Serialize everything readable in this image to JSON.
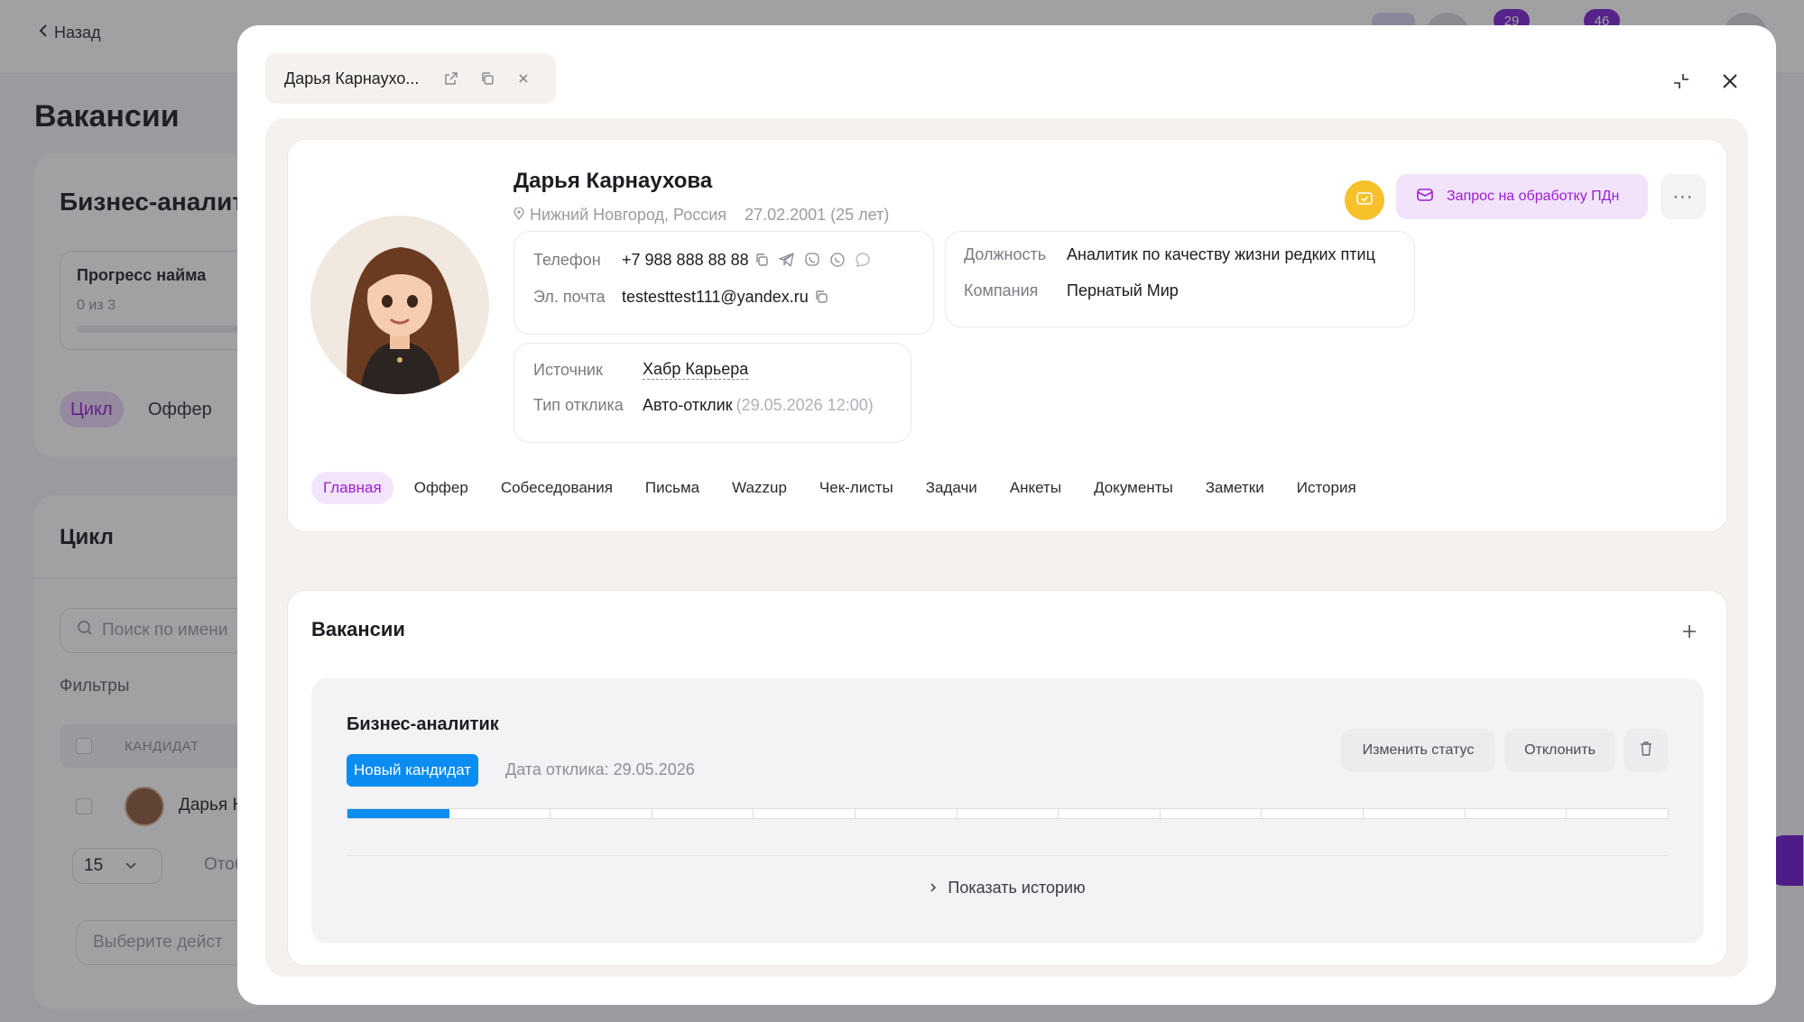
{
  "background": {
    "back_label": "Назад",
    "page_title": "Вакансии",
    "vacancy_title": "Бизнес-аналит",
    "progress_card": {
      "title": "Прогресс найма",
      "subtitle": "0 из 3"
    },
    "pills": [
      "Цикл",
      "Оффер"
    ],
    "cycle_title": "Цикл",
    "search_placeholder": "Поиск по имени",
    "filters_label": "Фильтры",
    "table_header": "КАНДИДАТ",
    "row_name": "Дарья К",
    "page_size": "15",
    "page_size_suffix": "Отоб",
    "action_placeholder": "Выберите дейст",
    "badges": [
      "29",
      "46"
    ]
  },
  "modal": {
    "tab_name": "Дарья Карнаухо...",
    "candidate": {
      "name": "Дарья Карнаухова",
      "location": "Нижний Новгород, Россия",
      "birth": "27.02.2001 (25 лет)",
      "phone_label": "Телефон",
      "phone": "+7 988 888 88 88",
      "email_label": "Эл. почта",
      "email": "testesttest111@yandex.ru",
      "position_label": "Должность",
      "position": "Аналитик по качеству жизни редких птиц",
      "company_label": "Компания",
      "company": "Пернатый Мир",
      "source_label": "Источник",
      "source": "Хабр Карьера",
      "response_type_label": "Тип отклика",
      "response_type": "Авто-отклик",
      "response_time": "(29.05.2026 12:00)"
    },
    "pdn_button": "Запрос на обработку ПДн",
    "more_button": "···",
    "tabs": [
      "Главная",
      "Оффер",
      "Собеседования",
      "Письма",
      "Wazzup",
      "Чек-листы",
      "Задачи",
      "Анкеты",
      "Документы",
      "Заметки",
      "История"
    ],
    "active_tab": "Главная",
    "vacancies": {
      "title": "Вакансии",
      "item": {
        "title": "Бизнес-аналитик",
        "status": "Новый кандидат",
        "response_date": "Дата отклика: 29.05.2026",
        "change_status": "Изменить статус",
        "reject": "Отклонить",
        "progress_total_steps": 13,
        "progress_done_steps": 1,
        "show_history": "Показать историю"
      }
    }
  },
  "colors": {
    "accent_purple": "#9b1fd4",
    "status_blue": "#0a8cf0",
    "yellow": "#f7c12b"
  },
  "icons": [
    "chevron-left-icon",
    "external-link-icon",
    "copy-icon",
    "close-icon",
    "collapse-icon",
    "location-pin-icon",
    "telegram-icon",
    "viber-icon",
    "whatsapp-icon",
    "chat-icon",
    "mail-check-icon",
    "plus-icon",
    "trash-icon",
    "chevron-right-icon",
    "search-icon",
    "chevron-down-icon"
  ]
}
